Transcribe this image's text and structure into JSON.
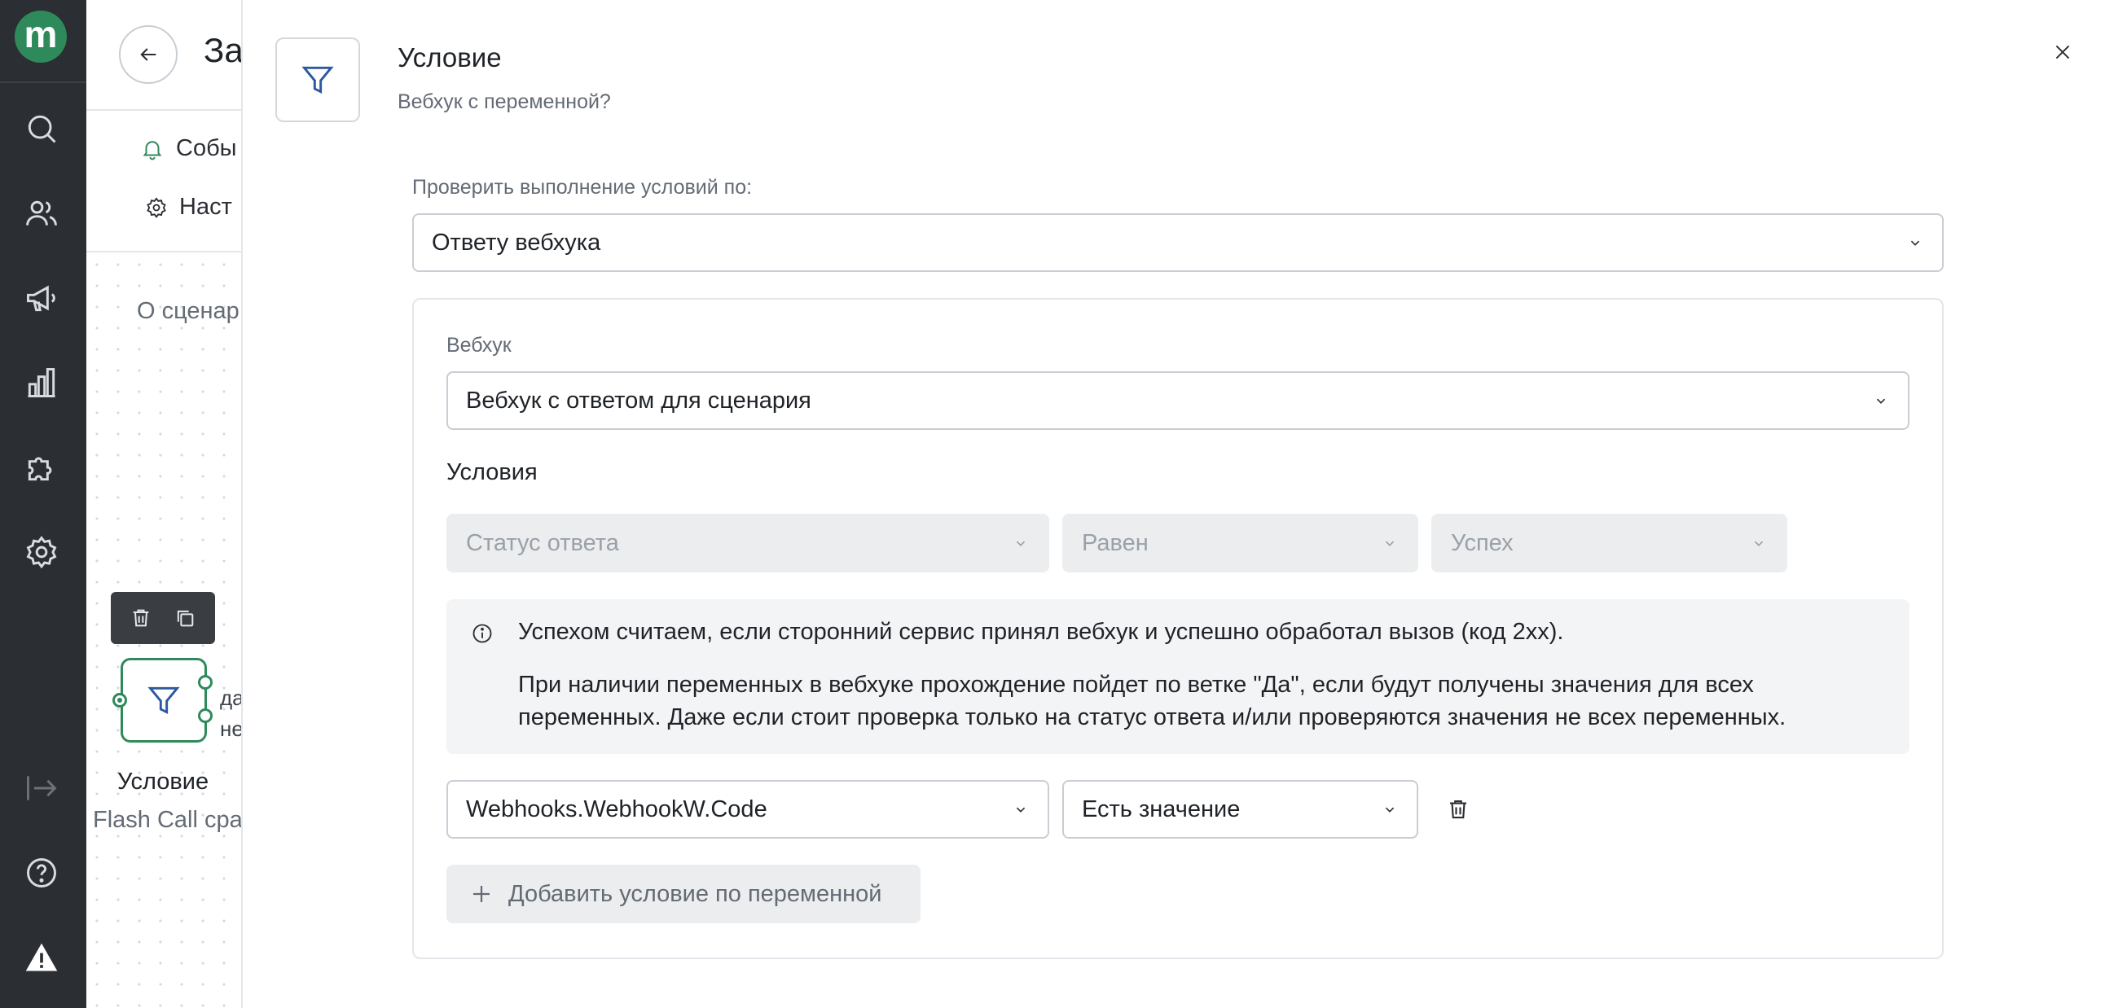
{
  "rail": {
    "logo_letter": "m",
    "icons": [
      "search-icon",
      "users-icon",
      "megaphone-icon",
      "chart-icon",
      "puzzle-icon",
      "gear-icon",
      "logout-icon",
      "help-icon",
      "warning-icon"
    ]
  },
  "background": {
    "page_title": "За",
    "menu_events": "Собы",
    "menu_settings": "Наст",
    "about_label": "О сценар",
    "node_label": "Условие",
    "node_sub": "Flash Call сра",
    "branch_yes": "да",
    "branch_no": "не"
  },
  "modal": {
    "title": "Условие",
    "subtitle": "Вебхук с переменной?",
    "check_label": "Проверить выполнение условий по:",
    "check_value": "Ответу вебхука",
    "webhook_label": "Вебхук",
    "webhook_value": "Вебхук с ответом для сценария",
    "conditions_title": "Условия",
    "status_placeholder": "Статус ответа",
    "equals_placeholder": "Равен",
    "success_placeholder": "Успех",
    "info_line1": "Успехом считаем, если сторонний сервис принял вебхук и успешно обработал вызов (код 2хх).",
    "info_line2": "При наличии переменных в вебхуке прохождение пойдет по ветке \"Да\", если будут получены значения для всех переменных. Даже если стоит проверка только на статус ответа и/или проверяются значения не всех переменных.",
    "variable_value": "Webhooks.WebhookW.Code",
    "operator_value": "Есть значение",
    "add_condition_label": "Добавить условие по переменной"
  },
  "colors": {
    "rail_bg": "#2b2e33",
    "brand_green": "#2f8a5b",
    "accent_blue": "#2c5aa0",
    "disabled_bg": "#ebedef"
  }
}
